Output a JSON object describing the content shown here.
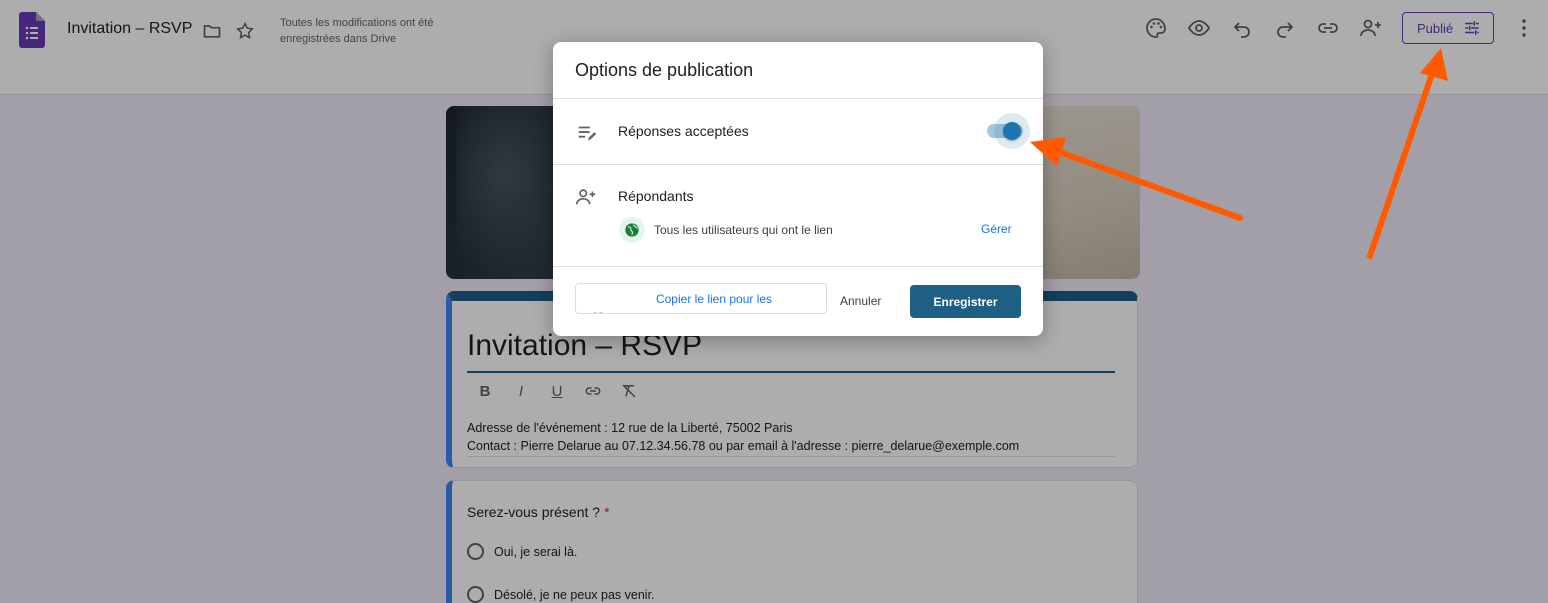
{
  "app": {
    "doc_title": "Invitation – RSVP",
    "save_status": "Toutes les modifications ont été enregistrées dans Drive",
    "publish_label": "Publié"
  },
  "form": {
    "title": "Invitation – RSVP",
    "format_buttons": [
      "B",
      "I",
      "U"
    ],
    "description_line1": "Adresse de l'événement : 12 rue de la Liberté, 75002 Paris",
    "description_line2": "Contact : Pierre Delarue au 07.12.34.56.78 ou par email à l'adresse : pierre_delarue@exemple.com"
  },
  "question": {
    "title": "Serez-vous présent ?",
    "required_mark": "*",
    "options": [
      "Oui, je serai là.",
      "Désolé, je ne peux pas venir."
    ]
  },
  "dialog": {
    "title": "Options de publication",
    "responses_label": "Réponses acceptées",
    "responses_accepted": true,
    "respondents_label": "Répondants",
    "audience": "Tous les utilisateurs qui ont le lien",
    "manage_label": "Gérer",
    "copy_link_label": "Copier le lien pour les",
    "cancel_label": "Annuler",
    "save_label": "Enregistrer"
  },
  "colors": {
    "theme": "#1e5f86",
    "accent_purple": "#673ab7",
    "annotation_arrow": "#ff5a00",
    "link_blue": "#1a73e8"
  }
}
